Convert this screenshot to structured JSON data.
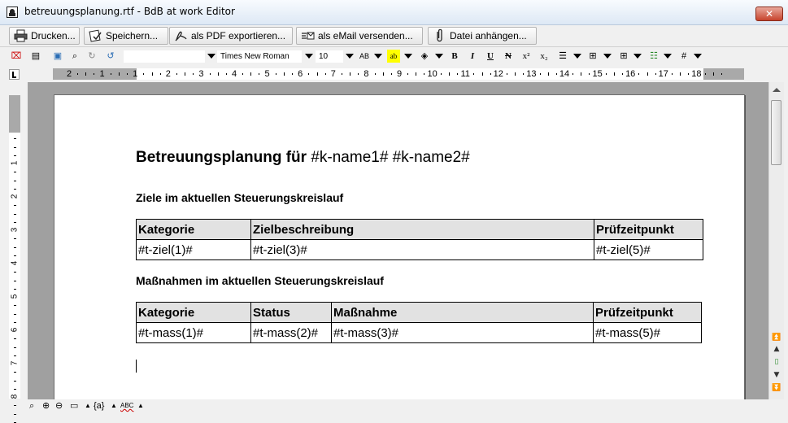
{
  "window": {
    "title": "betreuungsplanung.rtf - BdB at work Editor",
    "close_label": "✕"
  },
  "actions": [
    {
      "label": "Drucken...",
      "icon": "printer-icon"
    },
    {
      "label": "Speichern...",
      "icon": "save-icon"
    },
    {
      "label": "als PDF exportieren...",
      "icon": "pdf-icon"
    },
    {
      "label": "als eMail versenden...",
      "icon": "email-icon"
    },
    {
      "label": "Datei anhängen...",
      "icon": "paperclip-icon"
    }
  ],
  "format_toolbar": {
    "style_value": "",
    "font_value": "Times New Roman",
    "size_value": "10",
    "bold": "B",
    "italic": "I",
    "underline": "U",
    "strikethrough": "N",
    "superscript": "x²",
    "subscript": "x₂",
    "hash": "#"
  },
  "ruler": {
    "numbers": [
      "2",
      "1",
      "1",
      "2",
      "3",
      "4",
      "5",
      "6",
      "7",
      "8",
      "9",
      "10",
      "11",
      "12",
      "13",
      "14",
      "15",
      "16",
      "17",
      "18"
    ],
    "vertical_numbers": [
      "1",
      "2",
      "3",
      "4",
      "5",
      "6",
      "7",
      "8"
    ]
  },
  "document": {
    "title_bold": "Betreuungsplanung für",
    "title_rest": "#k-name1# #k-name2#",
    "section1": "Ziele im aktuellen Steuerungskreislauf",
    "table1": {
      "headers": [
        "Kategorie",
        "Zielbeschreibung",
        "Prüfzeitpunkt"
      ],
      "row": [
        "#t-ziel(1)#",
        "#t-ziel(3)#",
        "#t-ziel(5)#"
      ]
    },
    "section2": "Maßnahmen im aktuellen Steuerungskreislauf",
    "table2": {
      "headers": [
        "Kategorie",
        "Status",
        "Maßnahme",
        "Prüfzeitpunkt"
      ],
      "row": [
        "#t-mass(1)#",
        "#t-mass(2)#",
        "#t-mass(3)#",
        "#t-mass(5)#"
      ]
    }
  },
  "statusbar": {
    "field_code": "{a}",
    "spell": "ABC"
  },
  "colors": {
    "accent_close": "#c7432c",
    "table_header_bg": "#e2e2e2",
    "page_bg": "#a0a0a0"
  }
}
